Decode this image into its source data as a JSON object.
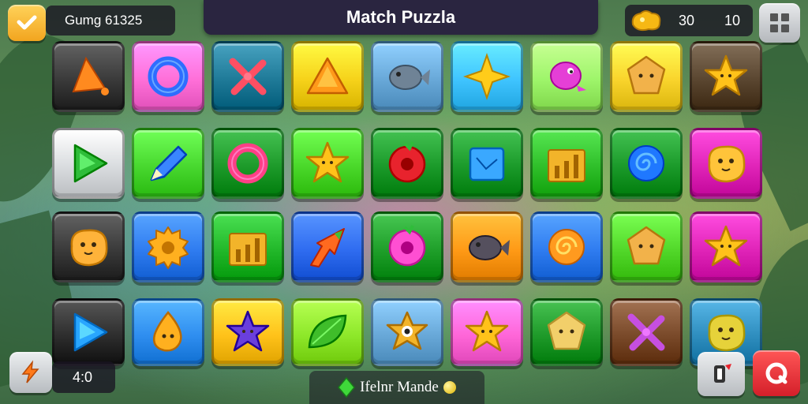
{
  "header": {
    "score_label": "Gumg 61325",
    "title": "Match Puzzla",
    "coins_a": "30",
    "coins_b": "10"
  },
  "footer": {
    "moves": "4:0",
    "status_text": "Ifelnr Mande"
  },
  "icons": {
    "menu": "check-menu-icon",
    "grid": "grid-menu-icon",
    "coin": "gold-nugget-icon",
    "bolt": "lightning-icon",
    "card": "card-exit-icon",
    "record": "record-icon",
    "status_gem": "green-gem-icon"
  },
  "board": {
    "rows": [
      [
        {
          "bg": "#3a3a3a",
          "piece": "cone",
          "color": "#ff8a1f"
        },
        {
          "bg": "#ff6fd8",
          "piece": "ring",
          "color": "#2e6dff"
        },
        {
          "bg": "#1f7a98",
          "piece": "cross",
          "color": "#ff4f63"
        },
        {
          "bg": "#f6d21a",
          "piece": "triangle",
          "color": "#ff9a1a"
        },
        {
          "bg": "#68a8d8",
          "piece": "fish",
          "color": "#6f8396"
        },
        {
          "bg": "#3fc4ff",
          "piece": "star4",
          "color": "#ffcc1a"
        },
        {
          "bg": "#9ef56a",
          "piece": "bird",
          "color": "#e53fd6"
        },
        {
          "bg": "#f9d42c",
          "piece": "pentagon",
          "color": "#f2b24a"
        },
        {
          "bg": "#5a4630",
          "piece": "star",
          "color": "#ffc21a"
        }
      ],
      [
        {
          "bg": "#d9dcdf",
          "piece": "play",
          "color": "#2fbd3a"
        },
        {
          "bg": "#48d82f",
          "piece": "pencil",
          "color": "#3a86ff"
        },
        {
          "bg": "#1d9a2a",
          "piece": "ring",
          "color": "#ff3f86"
        },
        {
          "bg": "#4ad82a",
          "piece": "star",
          "color": "#ffc21a"
        },
        {
          "bg": "#1b9a2a",
          "piece": "donut",
          "color": "#e8232d"
        },
        {
          "bg": "#1b9a2a",
          "piece": "square",
          "color": "#3aa8ff"
        },
        {
          "bg": "#2fbf2a",
          "piece": "bars",
          "color": "#f2b42a"
        },
        {
          "bg": "#1b9a2a",
          "piece": "swirl",
          "color": "#1f78ff"
        },
        {
          "bg": "#e024b8",
          "piece": "blob",
          "color": "#ffc43a"
        }
      ],
      [
        {
          "bg": "#3a3a3a",
          "piece": "blob",
          "color": "#ffb33a"
        },
        {
          "bg": "#2f7cf0",
          "piece": "gear",
          "color": "#ffb01f"
        },
        {
          "bg": "#22b82a",
          "piece": "bars",
          "color": "#f2b42a"
        },
        {
          "bg": "#2f6cf0",
          "piece": "arrow",
          "color": "#ff6a1f"
        },
        {
          "bg": "#1f9f2a",
          "piece": "donut",
          "color": "#ff4fd2"
        },
        {
          "bg": "#ff9a16",
          "piece": "fish",
          "color": "#55505e"
        },
        {
          "bg": "#2f7cf0",
          "piece": "swirl",
          "color": "#ff9a1f"
        },
        {
          "bg": "#52d82a",
          "piece": "pentagon",
          "color": "#f2b24a"
        },
        {
          "bg": "#e024b8",
          "piece": "star",
          "color": "#ffc21a"
        }
      ],
      [
        {
          "bg": "#2e2e2e",
          "piece": "play",
          "color": "#29a6ff"
        },
        {
          "bg": "#2f8ef0",
          "piece": "drop",
          "color": "#ffb01f"
        },
        {
          "bg": "#ffc21a",
          "piece": "star",
          "color": "#6a3fdc"
        },
        {
          "bg": "#8ee82a",
          "piece": "leaf",
          "color": "#3fbd2a"
        },
        {
          "bg": "#68a8d8",
          "piece": "eye",
          "color": "#f2b42a"
        },
        {
          "bg": "#ff66d8",
          "piece": "star",
          "color": "#ffc21a"
        },
        {
          "bg": "#1f9a2a",
          "piece": "pentagon",
          "color": "#f2cf6a"
        },
        {
          "bg": "#7a4a2a",
          "piece": "cross",
          "color": "#c64fe0"
        },
        {
          "bg": "#2f8ebf",
          "piece": "blob",
          "color": "#e6d23a"
        }
      ]
    ]
  }
}
